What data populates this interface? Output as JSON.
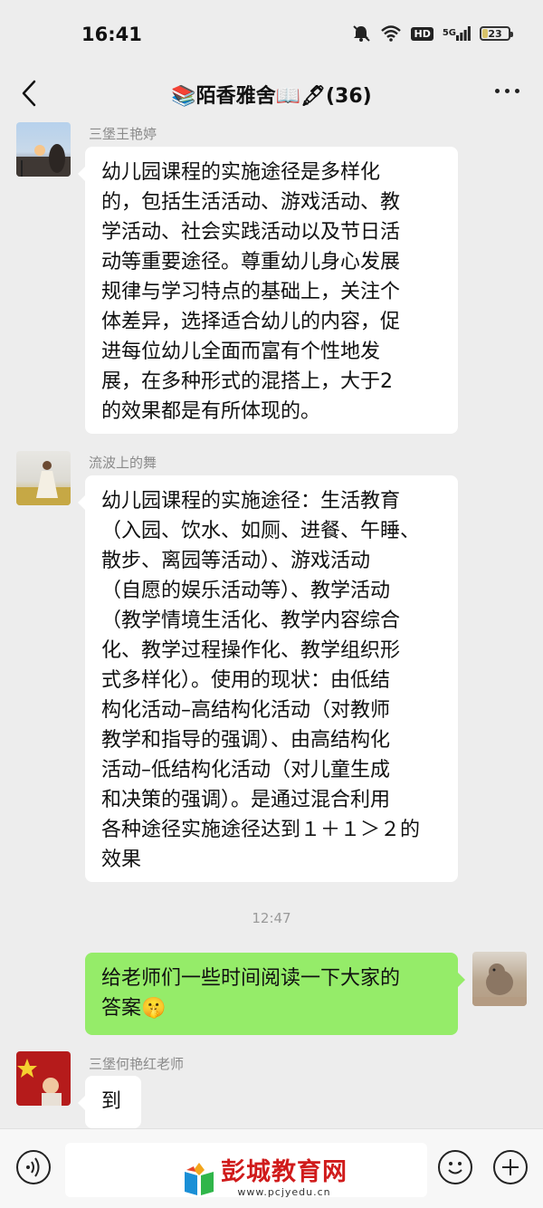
{
  "status_bar": {
    "time": "16:41",
    "network": "5G",
    "hd": "HD",
    "battery": "23",
    "battery_level": 0.23
  },
  "header": {
    "title": "📚陌香雅舍📖🖋(36)"
  },
  "messages": [
    {
      "sender": "三堡王艳婷",
      "side": "left",
      "lines": [
        "幼儿园课程的实施途径是多样化",
        "的，包括生活活动、游戏活动、教",
        "学活动、社会实践活动以及节日活",
        "动等重要途径。尊重幼儿身心发展",
        "规律与学习特点的基础上，关注个",
        "体差异，选择适合幼儿的内容，促",
        "进每位幼儿全面而富有个性地发",
        "展，在多种形式的混搭上，大于2",
        "的效果都是有所体现的。"
      ]
    },
    {
      "sender": "流波上的舞",
      "side": "left",
      "lines": [
        "幼儿园课程的实施途径：生活教育",
        "（入园、饮水、如厕、进餐、午睡、",
        "散步、离园等活动）、游戏活动",
        "（自愿的娱乐活动等）、教学活动",
        "（教学情境生活化、教学内容综合",
        "化、教学过程操作化、教学组织形",
        "式多样化）。使用的现状：由低结",
        "构化活动–高结构化活动（对教师",
        "教学和指导的强调）、由高结构化",
        "活动–低结构化活动（对儿童生成",
        "和决策的强调）。是通过混合利用",
        "各种途径实施途径达到１＋１＞２的",
        "效果"
      ]
    },
    {
      "timestamp": "12:47"
    },
    {
      "sender": "",
      "side": "right",
      "lines": [
        "给老师们一些时间阅读一下大家的",
        "答案🤫"
      ]
    },
    {
      "sender": "三堡何艳红老师",
      "side": "left",
      "lines": [
        "到"
      ]
    }
  ],
  "watermark": {
    "title": "彭城教育网",
    "url": "www.pcjyedu.cn"
  },
  "icons": {
    "back": "chevron-left-icon",
    "more": "more-icon",
    "voice": "voice-icon",
    "emoji": "emoji-icon",
    "plus": "plus-icon"
  }
}
